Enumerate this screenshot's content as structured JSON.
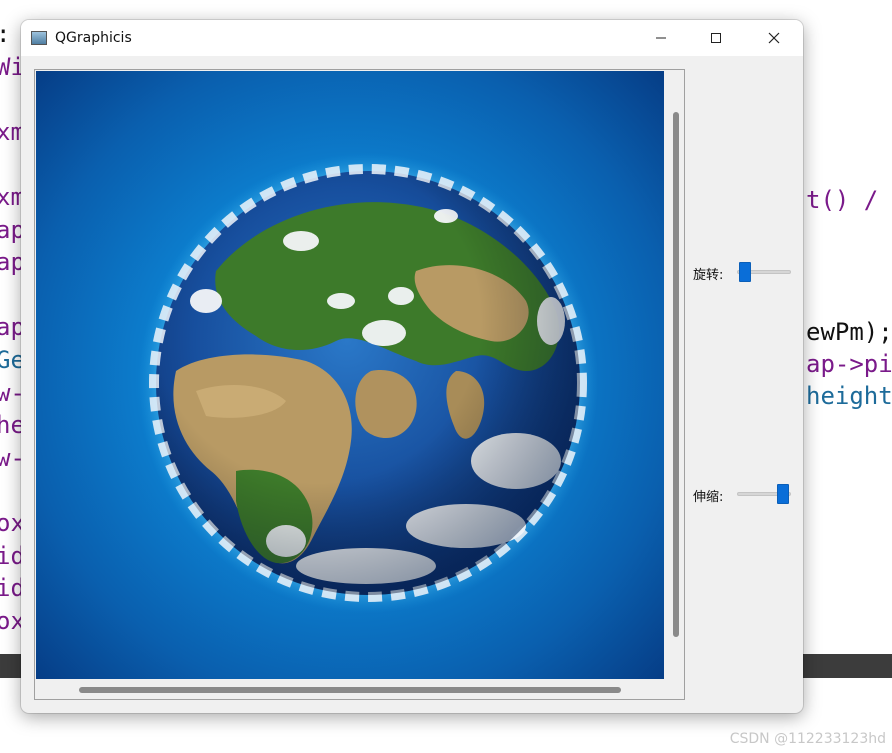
{
  "background_code": [
    {
      "text": ": W",
      "cls": "dk"
    },
    {
      "text": "Wi",
      "cls": "kw"
    },
    {
      "text": "",
      "cls": "dk"
    },
    {
      "text": "xm",
      "cls": "kw"
    },
    {
      "text": "",
      "cls": "dk"
    },
    {
      "text": "xm",
      "cls": "kw"
    },
    {
      "text": "ap",
      "cls": "kw"
    },
    {
      "text": "ap",
      "cls": "kw"
    },
    {
      "text": "",
      "cls": "dk"
    },
    {
      "text": "ap",
      "cls": "kw"
    },
    {
      "text": "Ge",
      "cls": "ty"
    },
    {
      "text": "w-",
      "cls": "kw"
    },
    {
      "text": "he",
      "cls": "kw"
    },
    {
      "text": "w-",
      "cls": "kw"
    },
    {
      "text": "",
      "cls": "dk"
    },
    {
      "text": "ox",
      "cls": "kw"
    },
    {
      "text": "id",
      "cls": "kw"
    },
    {
      "text": "id",
      "cls": "kw"
    },
    {
      "text": "ox",
      "cls": "kw"
    }
  ],
  "background_code_right": [
    {
      "text": "t() /",
      "cls": "kw"
    },
    {
      "text": "ewPm);",
      "cls": "dk"
    },
    {
      "text": "ap->pi",
      "cls": "kw"
    },
    {
      "text": "height",
      "cls": "ty"
    }
  ],
  "watermark": "CSDN @112233123hd",
  "window": {
    "title": "QGraphicis",
    "icon": "window-app-icon",
    "buttons": [
      "minimize-icon",
      "maximize-icon",
      "close-icon"
    ]
  },
  "controls": {
    "rotate_label": "旋转:",
    "rotate_value": 0.05,
    "scale_label": "伸缩:",
    "scale_value": 0.95
  },
  "colors": {
    "accent": "#0a6ed8",
    "ocean": "#0c7fcf",
    "land_green": "#3d7a2a",
    "land_tan": "#b89a64",
    "cloud": "#f4f6f8"
  }
}
